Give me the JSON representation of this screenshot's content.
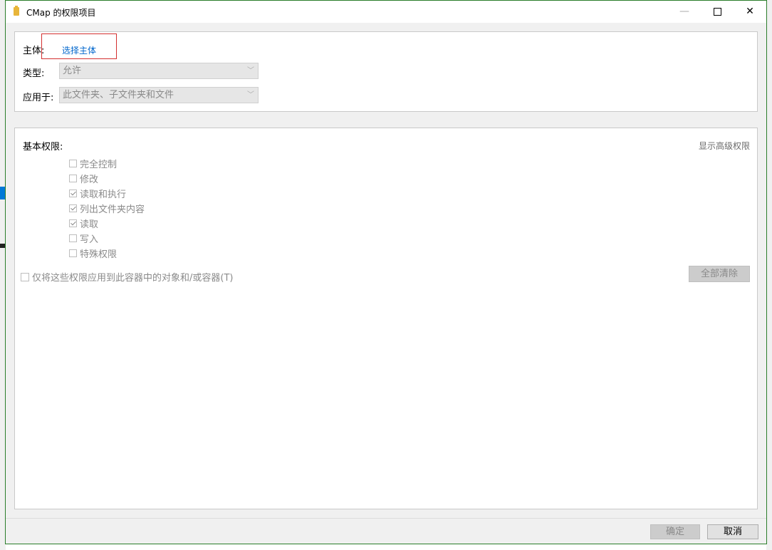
{
  "window": {
    "title": "CMap 的权限项目",
    "minimize_glyph": "—",
    "close_glyph": "✕"
  },
  "principal": {
    "label": "主体:",
    "select_link": "选择主体"
  },
  "type": {
    "label": "类型:",
    "value": "允许"
  },
  "applies_to": {
    "label": "应用于:",
    "value": "此文件夹、子文件夹和文件"
  },
  "basic_permissions": {
    "label": "基本权限:",
    "show_advanced_link": "显示高级权限",
    "items": [
      {
        "label": "完全控制",
        "checked": false
      },
      {
        "label": "修改",
        "checked": false
      },
      {
        "label": "读取和执行",
        "checked": true
      },
      {
        "label": "列出文件夹内容",
        "checked": true
      },
      {
        "label": "读取",
        "checked": true
      },
      {
        "label": "写入",
        "checked": false
      },
      {
        "label": "特殊权限",
        "checked": false
      }
    ],
    "apply_only_label": "仅将这些权限应用到此容器中的对象和/或容器(T)",
    "clear_all_label": "全部清除"
  },
  "footer": {
    "ok_label": "确定",
    "cancel_label": "取消"
  },
  "icons": {
    "title": "folder-icon",
    "dropdown": "chevron-down-icon"
  },
  "colors": {
    "link": "#0066cc",
    "highlight_box": "#d32f2f",
    "window_border": "#2a7d2a"
  }
}
